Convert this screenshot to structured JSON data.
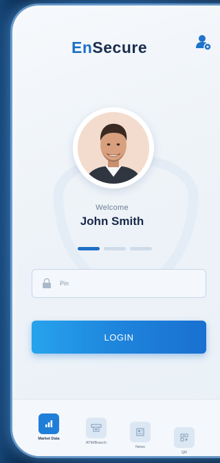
{
  "app": {
    "logo_prefix": "En",
    "logo_suffix": "Secure"
  },
  "profile": {
    "welcome_text": "Welcome",
    "user_name": "John Smith"
  },
  "carousel": {
    "pages": 3,
    "active_index": 0
  },
  "login_form": {
    "pin_placeholder": "Pin",
    "pin_value": "",
    "login_label": "LOGIN"
  },
  "bottom_nav": {
    "items": [
      {
        "label": "Market Data",
        "icon": "chart-icon",
        "active": true
      },
      {
        "label": "ATM/Branch",
        "icon": "atm-icon",
        "active": false
      },
      {
        "label": "News",
        "icon": "news-icon",
        "active": false
      },
      {
        "label": "QR",
        "icon": "qr-code-icon",
        "active": false
      }
    ]
  },
  "colors": {
    "brand_blue": "#1d6fc4",
    "brand_dark": "#1a2d4f",
    "button_start": "#27a3ec",
    "button_end": "#1a70d0"
  }
}
